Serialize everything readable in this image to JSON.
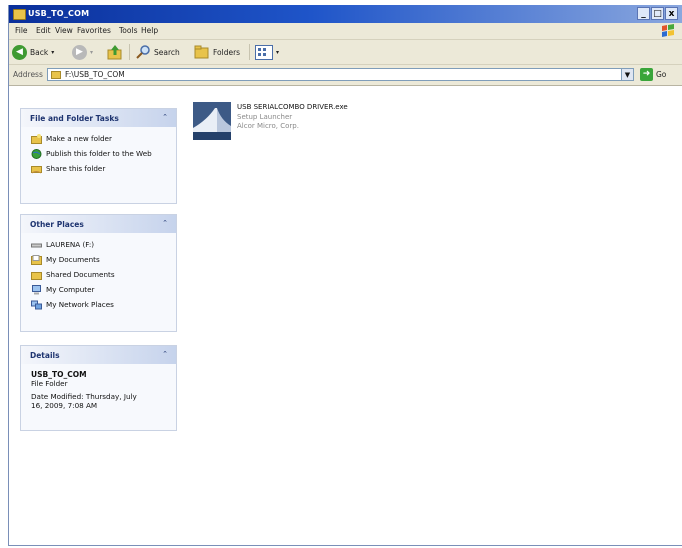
{
  "window": {
    "title": "USB_TO_COM",
    "controls": [
      "_",
      "□",
      "x"
    ]
  },
  "menu": [
    "File",
    "Edit",
    "View",
    "Favorites",
    "Tools",
    "Help"
  ],
  "toolbar": {
    "back": "Back",
    "search": "Search",
    "folders": "Folders"
  },
  "address": {
    "label": "Address",
    "path": "F:\\USB_TO_COM",
    "go": "Go"
  },
  "tasks": {
    "header": "File and Folder Tasks",
    "items": [
      "Make a new folder",
      "Publish this folder to the Web",
      "Share this folder"
    ]
  },
  "places": {
    "header": "Other Places",
    "items": [
      "LAURENA (F:)",
      "My Documents",
      "Shared Documents",
      "My Computer",
      "My Network Places"
    ]
  },
  "details": {
    "header": "Details",
    "name": "USB_TO_COM",
    "type": "File Folder",
    "modified_line1": "Date Modified: Thursday, July",
    "modified_line2": "16, 2009, 7:08 AM"
  },
  "file": {
    "name": "USB SERIALCOMBO DRIVER.exe",
    "description": "Setup Launcher",
    "company": "Alcor Micro, Corp."
  },
  "colors": {
    "title_bar": "#0a2f9a",
    "panel_header_text": "#1e3470",
    "chrome": "#ece9d8"
  }
}
